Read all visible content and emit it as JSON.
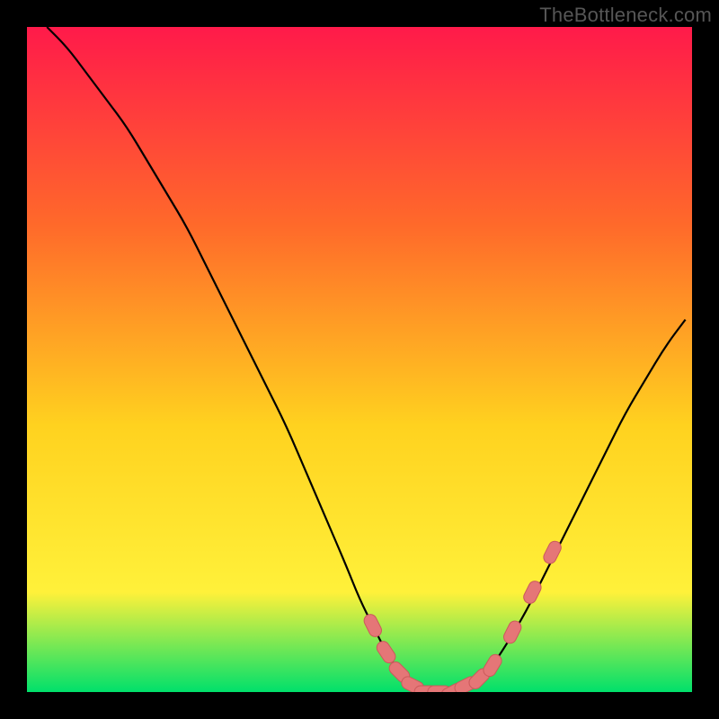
{
  "watermark": "TheBottleneck.com",
  "colors": {
    "frame": "#000000",
    "gradient_top": "#ff1a4a",
    "gradient_mid1": "#ff6a2a",
    "gradient_mid2": "#ffd21f",
    "gradient_mid3": "#fff13a",
    "gradient_bottom": "#00e06b",
    "curve": "#000000",
    "marker_fill": "#e57677",
    "marker_stroke": "#cb5a5b"
  },
  "chart_data": {
    "type": "line",
    "title": "",
    "xlabel": "",
    "ylabel": "",
    "xlim": [
      0,
      100
    ],
    "ylim": [
      0,
      100
    ],
    "series": [
      {
        "name": "bottleneck-curve",
        "x": [
          3,
          6,
          9,
          12,
          15,
          18,
          21,
          24,
          27,
          30,
          33,
          36,
          39,
          42,
          45,
          48,
          50,
          52,
          54,
          56,
          58,
          60,
          62,
          64,
          66,
          68,
          70,
          72,
          75,
          78,
          81,
          84,
          87,
          90,
          93,
          96,
          99
        ],
        "y": [
          100,
          97,
          93,
          89,
          85,
          80,
          75,
          70,
          64,
          58,
          52,
          46,
          40,
          33,
          26,
          19,
          14,
          10,
          6,
          3,
          1,
          0,
          0,
          0,
          1,
          2,
          4,
          7,
          12,
          18,
          24,
          30,
          36,
          42,
          47,
          52,
          56
        ]
      }
    ],
    "markers": {
      "name": "highlight-points",
      "x": [
        52,
        54,
        56,
        58,
        60,
        62,
        64,
        66,
        68,
        70,
        73,
        76,
        79
      ],
      "y": [
        10,
        6,
        3,
        1,
        0,
        0,
        0,
        1,
        2,
        4,
        9,
        15,
        21
      ]
    }
  }
}
